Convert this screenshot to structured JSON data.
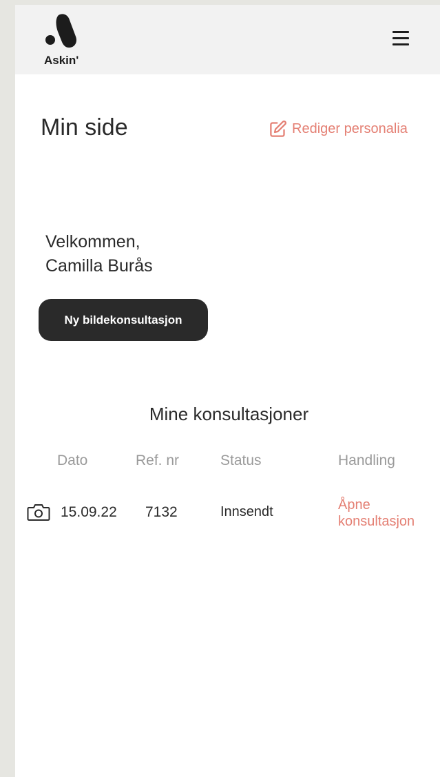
{
  "header": {
    "logo_text": "Askin'",
    "menu_icon": "hamburger-menu-icon"
  },
  "page": {
    "title": "Min side",
    "edit_link": "Rediger personalia",
    "edit_icon": "edit-icon"
  },
  "welcome": {
    "line1": "Velkommen,",
    "line2": "Camilla Burås"
  },
  "new_consultation_button": "Ny bildekonsultasjon",
  "consultations": {
    "title": "Mine konsultasjoner",
    "columns": [
      "Dato",
      "Ref. nr",
      "Status",
      "Handling"
    ],
    "rows": [
      {
        "icon": "camera-icon",
        "date": "15.09.22",
        "ref": "7132",
        "status": "Innsendt",
        "action_line1": "Åpne",
        "action_line2": "konsultasjon"
      }
    ]
  },
  "colors": {
    "accent": "#e47f73",
    "dark": "#2a2a2a",
    "header_bg": "#f2f2f2",
    "page_bg": "#e6e6e1"
  }
}
